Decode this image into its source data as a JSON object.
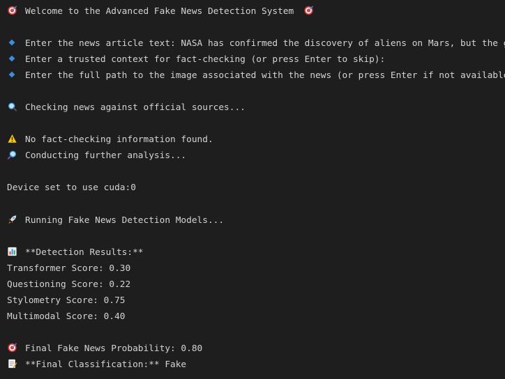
{
  "terminal": {
    "welcome": "Welcome to the Advanced Fake News Detection System",
    "prompt_article": "Enter the news article text: NASA has confirmed the discovery of aliens on Mars, but the gove",
    "prompt_context": "Enter a trusted context for fact-checking (or press Enter to skip):",
    "prompt_image": "Enter the full path to the image associated with the news (or press Enter if not available):",
    "checking": "Checking news against official sources...",
    "no_factcheck": "No fact-checking information found.",
    "further_analysis": "Conducting further analysis...",
    "device": "Device set to use cuda:0",
    "running": "Running Fake News Detection Models...",
    "results_header": "**Detection Results:**",
    "transformer": "Transformer Score: 0.30",
    "questioning": "Questioning Score: 0.22",
    "stylometry": "Stylometry Score: 0.75",
    "multimodal": "Multimodal Score: 0.40",
    "final_prob": "Final Fake News Probability: 0.80",
    "final_class": "**Final Classification:** Fake"
  },
  "icons": {
    "target": "target-icon",
    "diamond": "blue-diamond-icon",
    "search": "magnifier-left-icon",
    "warning": "warning-icon",
    "search_right": "magnifier-right-icon",
    "rocket": "rocket-icon",
    "chart": "bar-chart-icon",
    "memo": "memo-icon"
  },
  "colors": {
    "background": "#1e1e1e",
    "text": "#d4d4d4",
    "diamond": "#3b8fe0",
    "warning": "#f5c518",
    "target_red": "#e03a3a"
  }
}
